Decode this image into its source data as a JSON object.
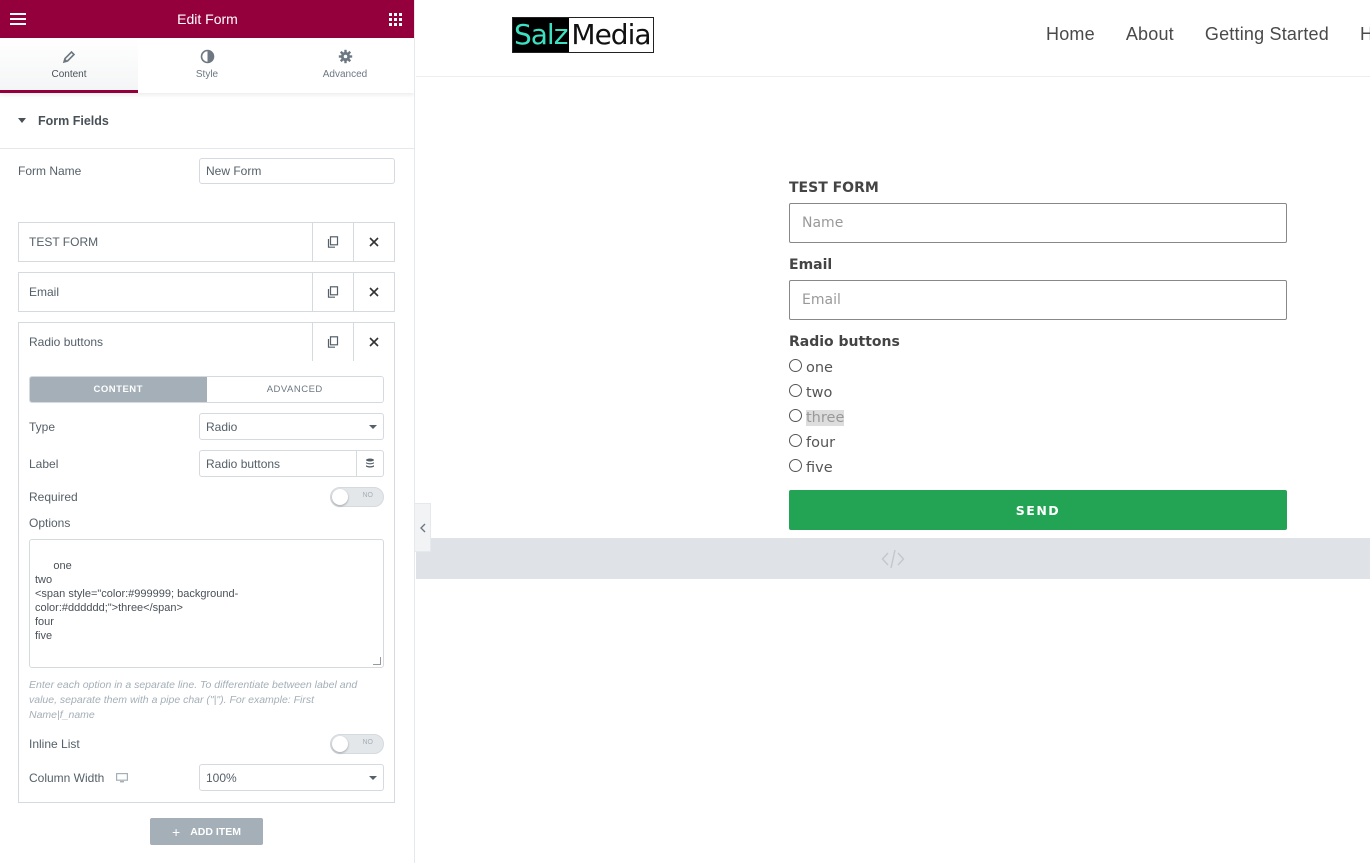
{
  "editor": {
    "title": "Edit Form",
    "tabs": [
      {
        "label": "Content",
        "icon": "pencil-icon"
      },
      {
        "label": "Style",
        "icon": "contrast-icon"
      },
      {
        "label": "Advanced",
        "icon": "gear-icon"
      }
    ],
    "section_title": "Form Fields",
    "form_name_label": "Form Name",
    "form_name_value": "New Form",
    "fields": [
      {
        "label": "TEST FORM"
      },
      {
        "label": "Email"
      },
      {
        "label": "Radio buttons"
      }
    ],
    "open_field": {
      "segment_tabs": [
        "CONTENT",
        "ADVANCED"
      ],
      "type_label": "Type",
      "type_value": "Radio",
      "label_label": "Label",
      "label_value": "Radio buttons",
      "required_label": "Required",
      "required_toggle": "NO",
      "options_label": "Options",
      "options_text": "one\ntwo\n<span style=\"color:#999999; background-\ncolor:#dddddd;\">three</span>\nfour\nfive",
      "options_note": "Enter each option in a separate line. To differentiate between label and value, separate them with a pipe char (\"|\"). For example: First Name|f_name",
      "inline_label": "Inline List",
      "inline_toggle": "NO",
      "width_label": "Column Width",
      "width_value": "100%"
    },
    "add_item_label": "ADD ITEM",
    "accent_color": "#93003c"
  },
  "site": {
    "logo_part1": "Salz",
    "logo_part2": "Media",
    "nav": [
      "Home",
      "About",
      "Getting Started",
      "H"
    ],
    "form": {
      "name_label": "TEST FORM",
      "name_placeholder": "Name",
      "email_label": "Email",
      "email_placeholder": "Email",
      "radio_label": "Radio buttons",
      "radio_options": [
        "one",
        "two",
        "three",
        "four",
        "five"
      ],
      "send_label": "SEND",
      "send_color": "#23a455"
    }
  }
}
